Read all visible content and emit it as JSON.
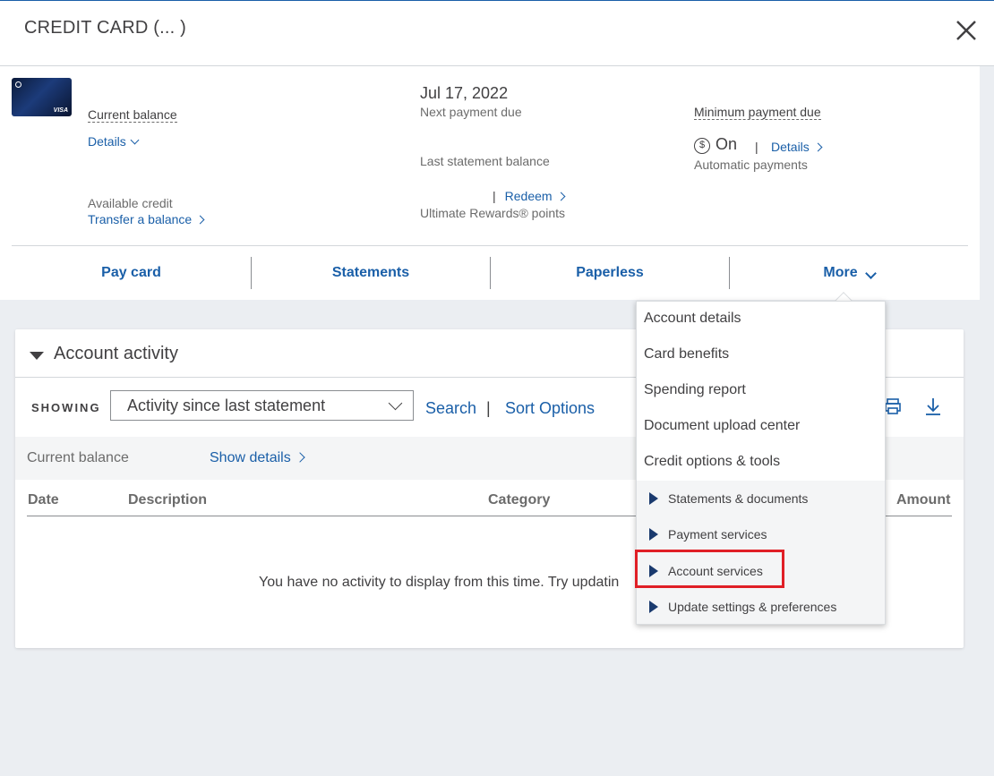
{
  "header": {
    "title": "CREDIT CARD (...        )"
  },
  "summary": {
    "card_brand": "VISA",
    "current_balance_label": "Current balance",
    "details_link": "Details",
    "available_credit_label": "Available credit",
    "transfer_link": "Transfer a balance",
    "next_payment_date": "Jul 17, 2022",
    "next_payment_label": "Next payment due",
    "last_statement_label": "Last statement balance",
    "redeem_link": "Redeem",
    "rewards_label": "Ultimate Rewards® points",
    "min_payment_label": "Minimum payment due",
    "autopay_status": "On",
    "autopay_details_link": "Details",
    "autopay_label": "Automatic payments"
  },
  "tabs": [
    {
      "label": "Pay card"
    },
    {
      "label": "Statements"
    },
    {
      "label": "Paperless"
    },
    {
      "label": "More"
    }
  ],
  "activity": {
    "title": "Account activity",
    "showing_label": "SHOWING",
    "filter_value": "Activity since last statement",
    "search_link": "Search",
    "sort_link": "Sort Options",
    "current_balance_label": "Current balance",
    "show_details_link": "Show details",
    "columns": [
      "Date",
      "Description",
      "Category",
      "Amount"
    ],
    "empty_message": "You have no activity to display from this time. Try updatin"
  },
  "more_menu": {
    "items": [
      "Account details",
      "Card benefits",
      "Spending report",
      "Document upload center",
      "Credit options & tools"
    ],
    "sub_items": [
      "Statements & documents",
      "Payment services",
      "Account services",
      "Update settings & preferences"
    ]
  },
  "colors": {
    "link": "#1a5fa8",
    "highlight": "#e01f26"
  }
}
